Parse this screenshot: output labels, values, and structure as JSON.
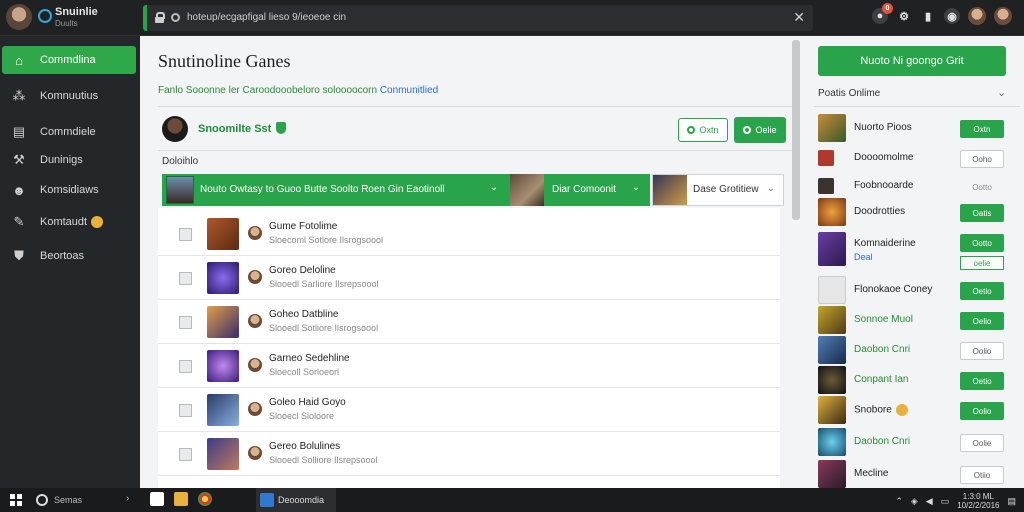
{
  "topbar": {
    "app_title": "Snuinlie",
    "app_subtitle": "Duults",
    "address": "hoteup/ecgapfigal lieso 9/ieoeoe cin",
    "close_glyph": "✕",
    "badge_count": "0",
    "icons": [
      "chat-icon",
      "settings-icon",
      "bookmark-icon",
      "record-icon",
      "user-avatar",
      "profile-avatar"
    ]
  },
  "sidebar": {
    "items": [
      {
        "label": "Commdlina",
        "icon": "home-icon",
        "active": true
      },
      {
        "label": "Komnuutius",
        "icon": "community-icon"
      },
      {
        "label": "Commdiele",
        "icon": "library-icon"
      },
      {
        "label": "Duninigs",
        "icon": "wrench-icon"
      },
      {
        "label": "Komsidiaws",
        "icon": "friends-icon"
      },
      {
        "label": "Komtaudt",
        "icon": "chat-icon",
        "coin": true
      },
      {
        "label": "Beortoas",
        "icon": "lock-icon"
      }
    ]
  },
  "main": {
    "title": "Snutinoline Ganes",
    "breadcrumb": "Fanlo Sooonne ler Caroodooobeloro soloooocorn",
    "breadcrumb_link": "Conmunitlied",
    "profile": {
      "name": "Snoomilte Sst",
      "btn_outline": "Oxtn",
      "btn_solid": "Oelie"
    },
    "section_label": "Doloihlo",
    "filters": [
      {
        "label": "Nouto Owtasy to Guoo Butte Soolto Roen Gin Eaotinoll"
      },
      {
        "label": "Diar Comoonit"
      },
      {
        "label": "Dase Grotitiew"
      }
    ],
    "games": [
      {
        "title": "Gume Fotolime",
        "sub": "Sloecoml Sotlore Ilsrogsoool",
        "color": "#b0582a"
      },
      {
        "title": "Goreo Deloline",
        "sub": "Slooedl Sarliore Ilsrepsoool",
        "color": "#5b3cc4"
      },
      {
        "title": "Goheo Datbline",
        "sub": "Slooedl Sotliore Ilsrogsoool",
        "color": "#c98a3a"
      },
      {
        "title": "Garneo Sedehline",
        "sub": "Sloecoll Sorloeorl",
        "color": "#7a3ec8"
      },
      {
        "title": "Goleo Haid Goyo",
        "sub": "Slooecl Sioloore",
        "color": "#4a6fb0"
      },
      {
        "title": "Gereo Bolulines",
        "sub": "Slooedl Solliore Ilsrepsoool",
        "color": "#3a3d8a"
      }
    ]
  },
  "right_panel": {
    "cta": "Nuoto Ni goongo Grit",
    "label": "Poatis Onlime",
    "friends": [
      {
        "name": "Nuorto Pioos",
        "btn": "Oxtn",
        "btn_style": "solid",
        "color": "#7b4a2a"
      },
      {
        "name": "Doooomolme",
        "btn": "Ooho",
        "btn_style": "outline",
        "color": "#b03a2a"
      },
      {
        "name": "Foobnooarde",
        "btn": "Ootto",
        "btn_style": "plain",
        "color": "#3a3330"
      },
      {
        "name": "Doodrotties",
        "btn": "Oatis",
        "btn_style": "solid",
        "color": "#c8701a"
      },
      {
        "name": "Komnaiderine",
        "btn": "Ootto",
        "btn_style": "solid",
        "color": "#6a3ea6",
        "sub": "Deal",
        "sub_btn": "oelie"
      },
      {
        "name": "Flonokaoe Coney",
        "btn": "Oetio",
        "btn_style": "solid",
        "color": "#c4c4c4"
      },
      {
        "name": "Sonnoe Muol",
        "btn": "Oelio",
        "btn_style": "solid",
        "color": "#c8a52a",
        "green": true
      },
      {
        "name": "Daobon Cnri",
        "btn": "Oolio",
        "btn_style": "outline",
        "color": "#4e7fb8",
        "green": true
      },
      {
        "name": "Conpant Ian",
        "btn": "Oetio",
        "btn_style": "solid",
        "color": "#2a2a2a",
        "green": true
      },
      {
        "name": "Snobore",
        "btn": "Oolio",
        "btn_style": "solid",
        "color": "#b08a2a",
        "gold": true
      },
      {
        "name": "Daobon Cnri",
        "btn": "Oolie",
        "btn_style": "outline",
        "color": "#2f8fb0",
        "green": true
      },
      {
        "name": "Mecline",
        "btn": "Otiio",
        "btn_style": "outline",
        "color": "#6a2a4a"
      }
    ]
  },
  "taskbar": {
    "search_label": "Semas",
    "active_app": "Deooomdia",
    "time": "1:3:0 ML",
    "date": "10/2/2/2016"
  },
  "colors": {
    "accent": "#2aa44a",
    "sidebar_bg": "#24272a",
    "main_bg": "#f3f4f5"
  }
}
